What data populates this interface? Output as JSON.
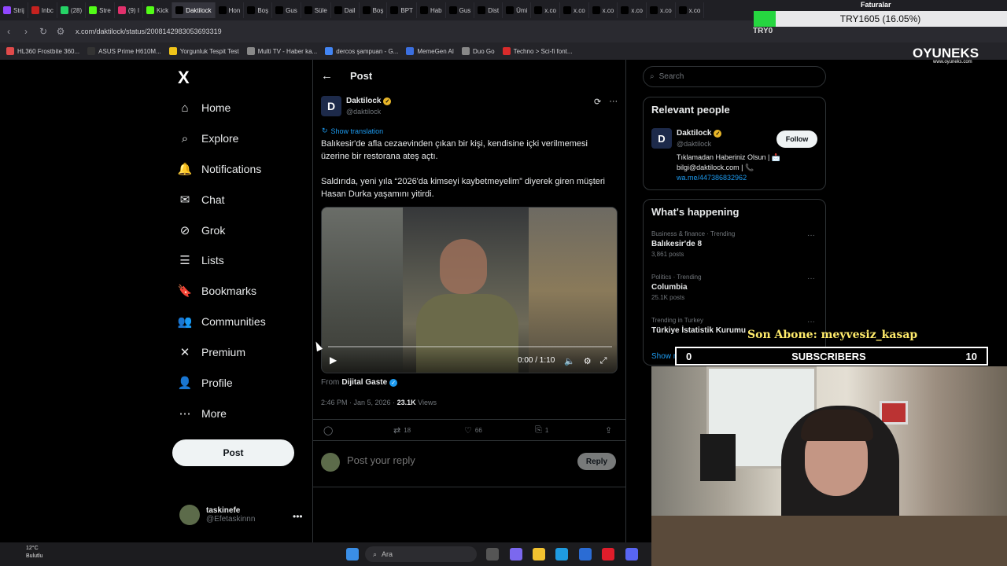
{
  "browser": {
    "tabs": [
      {
        "label": "Strij",
        "color": "#9147ff"
      },
      {
        "label": "Inbc",
        "color": "#c5221f"
      },
      {
        "label": "(28)",
        "color": "#25d366"
      },
      {
        "label": "Stre",
        "color": "#53fc18"
      },
      {
        "label": "(9) I",
        "color": "#e1306c"
      },
      {
        "label": "Kick",
        "color": "#53fc18"
      },
      {
        "label": "Daktilock",
        "color": "#000000",
        "active": true
      },
      {
        "label": "Hon",
        "color": "#000000"
      },
      {
        "label": "Boş",
        "color": "#000000"
      },
      {
        "label": "Gus",
        "color": "#000000"
      },
      {
        "label": "Süle",
        "color": "#000000"
      },
      {
        "label": "Dail",
        "color": "#000000"
      },
      {
        "label": "Boş",
        "color": "#000000"
      },
      {
        "label": "BPT",
        "color": "#000000"
      },
      {
        "label": "Hab",
        "color": "#000000"
      },
      {
        "label": "Gus",
        "color": "#000000"
      },
      {
        "label": "Dist",
        "color": "#000000"
      },
      {
        "label": "Ümi",
        "color": "#000000"
      },
      {
        "label": "x.co",
        "color": "#000000"
      },
      {
        "label": "x.co",
        "color": "#000000"
      },
      {
        "label": "x.co",
        "color": "#000000"
      },
      {
        "label": "x.co",
        "color": "#000000"
      },
      {
        "label": "x.co",
        "color": "#000000"
      },
      {
        "label": "x.co",
        "color": "#000000"
      }
    ],
    "url": "x.com/daktilock/status/2008142983053693319",
    "bookmarks": [
      {
        "label": "HL360 Frostbite 360...",
        "color": "#e04a4a"
      },
      {
        "label": "ASUS Prime H610M...",
        "color": "#333333"
      },
      {
        "label": "Yorgunluk Tespit Test",
        "color": "#f0c419"
      },
      {
        "label": "Multi TV - Haber ka...",
        "color": "#888888"
      },
      {
        "label": "dercos şampuan - G...",
        "color": "#4285f4"
      },
      {
        "label": "MemeGen AI",
        "color": "#3b6fe0"
      },
      {
        "label": "Duo Go",
        "color": "#888888"
      },
      {
        "label": "Techno > Sci-fi font...",
        "color": "#d92b2b"
      }
    ],
    "toolbar_label": "TRY0"
  },
  "overlays": {
    "goal_title": "Faturalar",
    "goal_text": "TRY1605 (16.05%)",
    "goal_fill_color": "#26d640",
    "goal_progress": 0.1605,
    "brand": "OYUNEKS",
    "brand_url": "www.oyuneks.com",
    "last_sub_label": "Son Abone: meyvesiz_kasap",
    "subs_current": "0",
    "subs_label": "SUBSCRIBERS",
    "subs_goal": "10"
  },
  "sidebar": {
    "logo": "X",
    "items": [
      {
        "label": "Home",
        "icon": "home-icon"
      },
      {
        "label": "Explore",
        "icon": "search-icon"
      },
      {
        "label": "Notifications",
        "icon": "bell-icon"
      },
      {
        "label": "Chat",
        "icon": "mail-icon"
      },
      {
        "label": "Grok",
        "icon": "grok-icon"
      },
      {
        "label": "Lists",
        "icon": "list-icon"
      },
      {
        "label": "Bookmarks",
        "icon": "bookmark-icon"
      },
      {
        "label": "Communities",
        "icon": "people-icon"
      },
      {
        "label": "Premium",
        "icon": "x-icon"
      },
      {
        "label": "Profile",
        "icon": "person-icon"
      },
      {
        "label": "More",
        "icon": "more-circle-icon"
      }
    ],
    "post_label": "Post",
    "account": {
      "name": "taskinefe",
      "handle": "@Efetaskinnn"
    }
  },
  "main": {
    "header_title": "Post",
    "author": {
      "name": "Daktilock",
      "handle": "@daktilock",
      "avatar_letter": "D"
    },
    "show_translation": "Show translation",
    "text_1": "Balıkesir'de afla cezaevinden çıkan bir kişi, kendisine içki verilmemesi üzerine bir restorana ateş açtı.",
    "text_2": "Saldırıda, yeni yıla “2026'da kimseyi kaybetmeyelim” diyerek giren müşteri Hasan Durka yaşamını yitirdi.",
    "video_time": "0:00 / 1:10",
    "from_label": "From",
    "from_source": "Dijital Gaste",
    "timestamp": "2:46 PM · Jan 5, 2026 ·",
    "views_count": "23.1K",
    "views_label": "Views",
    "retweets": "18",
    "likes": "66",
    "bookmarks": "1",
    "reply_placeholder": "Post your reply",
    "reply_button": "Reply"
  },
  "right": {
    "search_placeholder": "Search",
    "relevant_title": "Relevant people",
    "person": {
      "name": "Daktilock",
      "handle": "@daktilock",
      "follow": "Follow",
      "bio_line1": "Tıklamadan Haberiniz Olsun | 📩",
      "bio_line2": "bilgi@daktilock.com | 📞",
      "bio_link": "wa.me/447386832962"
    },
    "happening_title": "What's happening",
    "trends": [
      {
        "category": "Business & finance · Trending",
        "name": "Balıkesir'de 8",
        "count": "3,861 posts"
      },
      {
        "category": "Politics · Trending",
        "name": "Columbia",
        "count": "25.1K posts"
      },
      {
        "category": "Trending in Turkey",
        "name": "Türkiye İstatistik Kurumu",
        "count": ""
      }
    ],
    "show_more": "Show more"
  },
  "taskbar": {
    "temp": "12°C",
    "weather": "Bulutlu",
    "search_placeholder": "Ara"
  }
}
